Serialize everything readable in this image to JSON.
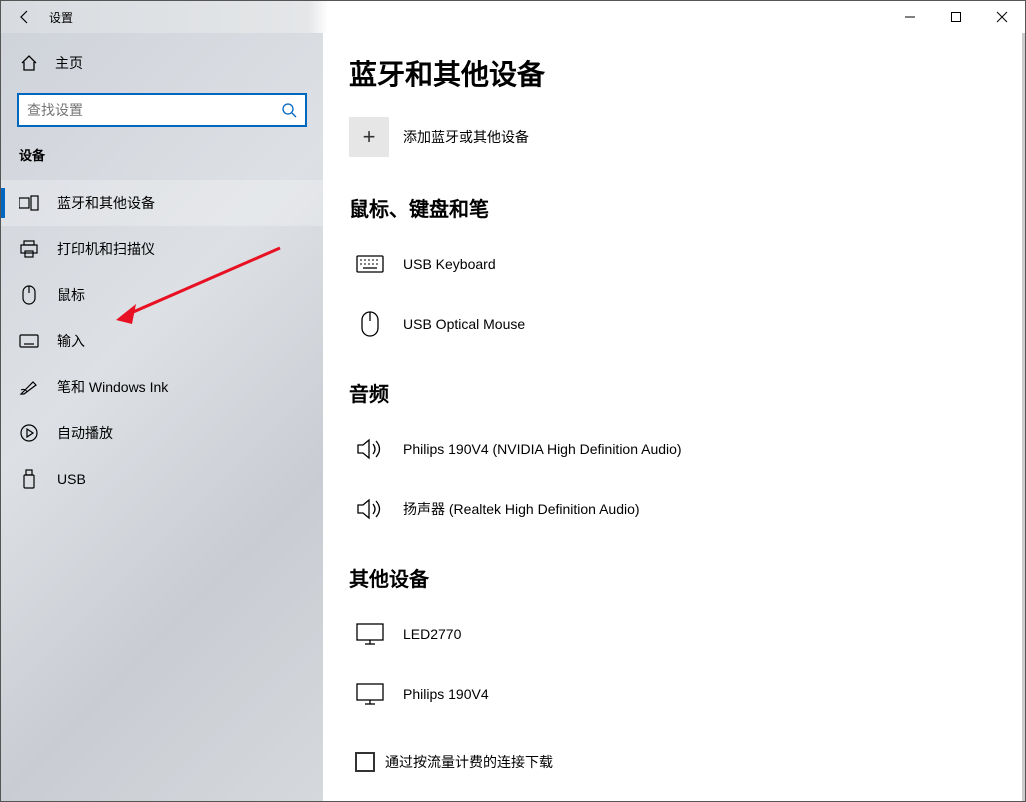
{
  "window": {
    "title": "设置"
  },
  "sidebar": {
    "home": "主页",
    "search_placeholder": "查找设置",
    "group": "设备",
    "items": [
      {
        "label": "蓝牙和其他设备",
        "icon": "bluetooth-devices-icon"
      },
      {
        "label": "打印机和扫描仪",
        "icon": "printer-icon"
      },
      {
        "label": "鼠标",
        "icon": "mouse-icon"
      },
      {
        "label": "输入",
        "icon": "keyboard-icon"
      },
      {
        "label": "笔和 Windows Ink",
        "icon": "pen-icon"
      },
      {
        "label": "自动播放",
        "icon": "autoplay-icon"
      },
      {
        "label": "USB",
        "icon": "usb-icon"
      }
    ]
  },
  "main": {
    "title": "蓝牙和其他设备",
    "add_label": "添加蓝牙或其他设备",
    "sections": {
      "input_devices": {
        "heading": "鼠标、键盘和笔",
        "items": [
          {
            "label": "USB Keyboard",
            "icon": "keyboard-device-icon"
          },
          {
            "label": "USB Optical Mouse",
            "icon": "mouse-device-icon"
          }
        ]
      },
      "audio": {
        "heading": "音频",
        "items": [
          {
            "label": "Philips 190V4 (NVIDIA High Definition Audio)",
            "icon": "speaker-icon"
          },
          {
            "label": "扬声器 (Realtek High Definition Audio)",
            "icon": "speaker-icon"
          }
        ]
      },
      "other": {
        "heading": "其他设备",
        "items": [
          {
            "label": "LED2770",
            "icon": "monitor-icon"
          },
          {
            "label": "Philips 190V4",
            "icon": "monitor-icon"
          }
        ]
      }
    },
    "metered_checkbox": "通过按流量计费的连接下载"
  }
}
